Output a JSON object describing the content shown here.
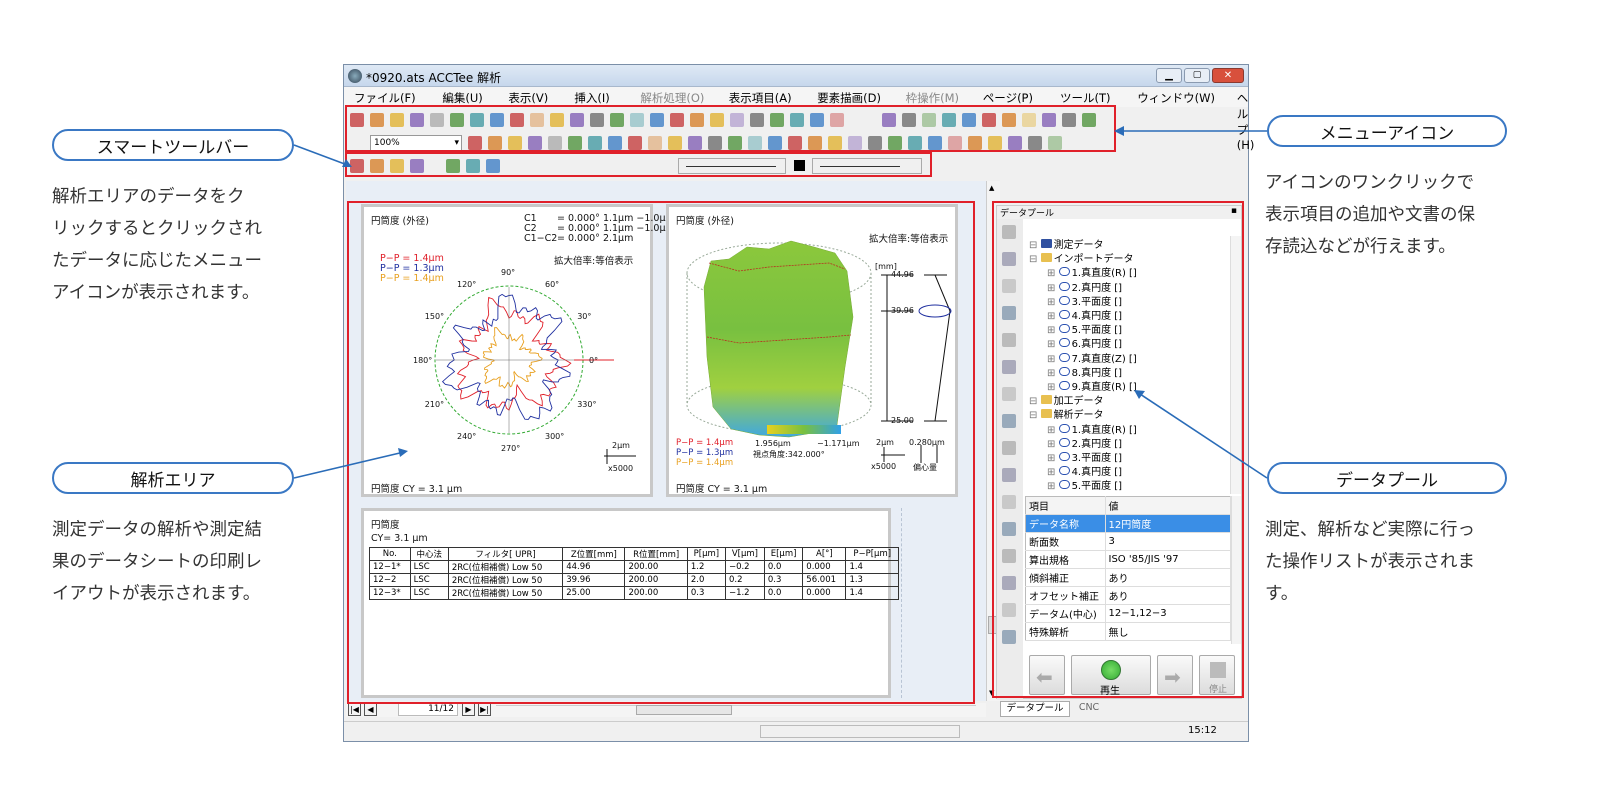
{
  "callouts": {
    "smart_toolbar": {
      "title": "スマートツールバー",
      "desc": [
        "解析エリアのデータをク",
        "リックするとクリックされ",
        "たデータに応じたメニュー",
        "アイコンが表示されます。"
      ]
    },
    "analysis_area": {
      "title": "解析エリア",
      "desc": [
        "測定データの解析や測定結",
        "果のデータシートの印刷レ",
        "イアウトが表示されます。"
      ]
    },
    "menu_icon": {
      "title": "メニューアイコン",
      "desc": [
        "アイコンのワンクリックで",
        "表示項目の追加や文書の保",
        "存読込などが行えます。"
      ]
    },
    "data_pool": {
      "title": "データプール",
      "desc": [
        "測定、解析など実際に行っ",
        "た操作リストが表示されま",
        "す。"
      ]
    }
  },
  "window": {
    "title": "*0920.ats ACCTee 解析",
    "menus": [
      "ファイル(F)",
      "編集(U)",
      "表示(V)",
      "挿入(I)",
      "解析処理(O)",
      "表示項目(A)",
      "要素描画(D)",
      "枠操作(M)",
      "ページ(P)",
      "ツール(T)",
      "ウィンドウ(W)",
      "ヘルプ(H)"
    ],
    "zoom": "100%"
  },
  "panel1": {
    "title": "円筒度 (外径)",
    "c1": "C1",
    "c1v": "= 0.000° 1.1μm −1.0μm",
    "c2": "C2",
    "c2v": "= 0.000° 1.1μm −1.0μm",
    "c12": "C1−C2",
    "c12v": "= 0.000° 2.1μm",
    "mag": "拡大倍率:等倍表示",
    "pp": [
      "P−P = 1.4μm",
      "P−P = 1.3μm",
      "P−P = 1.4μm"
    ],
    "angles": [
      "90°",
      "60°",
      "30°",
      "0°",
      "330°",
      "300°",
      "270°",
      "240°",
      "210°",
      "180°",
      "150°",
      "120°"
    ],
    "scale": "2μm",
    "scale2": "x5000",
    "footer": "円筒度 CY = 3.1 μm"
  },
  "panel2": {
    "title": "円筒度 (外径)",
    "mag": "拡大倍率:等倍表示",
    "mm": "[mm]",
    "z": [
      "44.96",
      "39.96",
      "25.00"
    ],
    "pp": [
      "P−P = 1.4μm",
      "P−P = 1.3μm",
      "P−P = 1.4μm"
    ],
    "range_min": "1.956μm",
    "range_max": "−1.171μm",
    "view": "視点角度:342.000°",
    "scale": "2μm",
    "scale2": "x5000",
    "ecc": "0.280μm",
    "ecc_label": "偏心量",
    "footer": "円筒度 CY = 3.1 μm"
  },
  "panel3": {
    "title": "円筒度",
    "cy": "CY= 3.1 μm",
    "headers": [
      "No.",
      "中心法",
      "フィルタ[ UPR]",
      "Z位置[mm]",
      "R位置[mm]",
      "P[μm]",
      "V[μm]",
      "E[μm]",
      "A[°]",
      "P−P[μm]"
    ],
    "rows": [
      [
        "12−1*",
        "LSC",
        "2RC(位相補償) Low 50",
        "44.96",
        "200.00",
        "1.2",
        "−0.2",
        "0.0",
        "0.000",
        "1.4"
      ],
      [
        "12−2",
        "LSC",
        "2RC(位相補償) Low 50",
        "39.96",
        "200.00",
        "2.0",
        "0.2",
        "0.3",
        "56.001",
        "1.3"
      ],
      [
        "12−3*",
        "LSC",
        "2RC(位相補償) Low 50",
        "25.00",
        "200.00",
        "0.3",
        "−1.2",
        "0.0",
        "0.000",
        "1.4"
      ]
    ]
  },
  "page_nav": {
    "page": "11/12"
  },
  "datapool": {
    "title": "データプール",
    "pin": "ꟸ",
    "tree": [
      {
        "indent": 1,
        "text": "測定データ",
        "icon": "M"
      },
      {
        "indent": 1,
        "text": "インポートデータ",
        "icon": "folder"
      },
      {
        "indent": 2,
        "text": "1.真直度(R) []"
      },
      {
        "indent": 2,
        "text": "2.真円度 []"
      },
      {
        "indent": 2,
        "text": "3.平面度 []"
      },
      {
        "indent": 2,
        "text": "4.真円度 []"
      },
      {
        "indent": 2,
        "text": "5.平面度 []"
      },
      {
        "indent": 2,
        "text": "6.真円度 []"
      },
      {
        "indent": 2,
        "text": "7.真直度(Z) []"
      },
      {
        "indent": 2,
        "text": "8.真円度 []"
      },
      {
        "indent": 2,
        "text": "9.真直度(R) []"
      },
      {
        "indent": 1,
        "text": "加工データ",
        "icon": "folder"
      },
      {
        "indent": 1,
        "text": "解析データ",
        "icon": "folder"
      },
      {
        "indent": 2,
        "text": "1.真直度(R) []"
      },
      {
        "indent": 2,
        "text": "2.真円度 []"
      },
      {
        "indent": 2,
        "text": "3.平面度 []"
      },
      {
        "indent": 2,
        "text": "4.真円度 []"
      },
      {
        "indent": 2,
        "text": "5.平面度 []"
      }
    ],
    "prop_headers": [
      "項目",
      "値"
    ],
    "props": [
      [
        "データ名称",
        "12円筒度"
      ],
      [
        "断面数",
        "3"
      ],
      [
        "算出規格",
        "ISO '85/JIS '97"
      ],
      [
        "傾斜補正",
        "あり"
      ],
      [
        "オフセット補正",
        "あり"
      ],
      [
        "データム(中心)",
        "12−1,12−3"
      ],
      [
        "特殊解析",
        "無し"
      ]
    ],
    "play": "再生",
    "stop": "停止",
    "tabs": [
      "データプール",
      "CNC"
    ]
  },
  "status": {
    "time": "15:12"
  },
  "colors": {
    "red": "#e0202a",
    "blue": "#3a78c4"
  }
}
